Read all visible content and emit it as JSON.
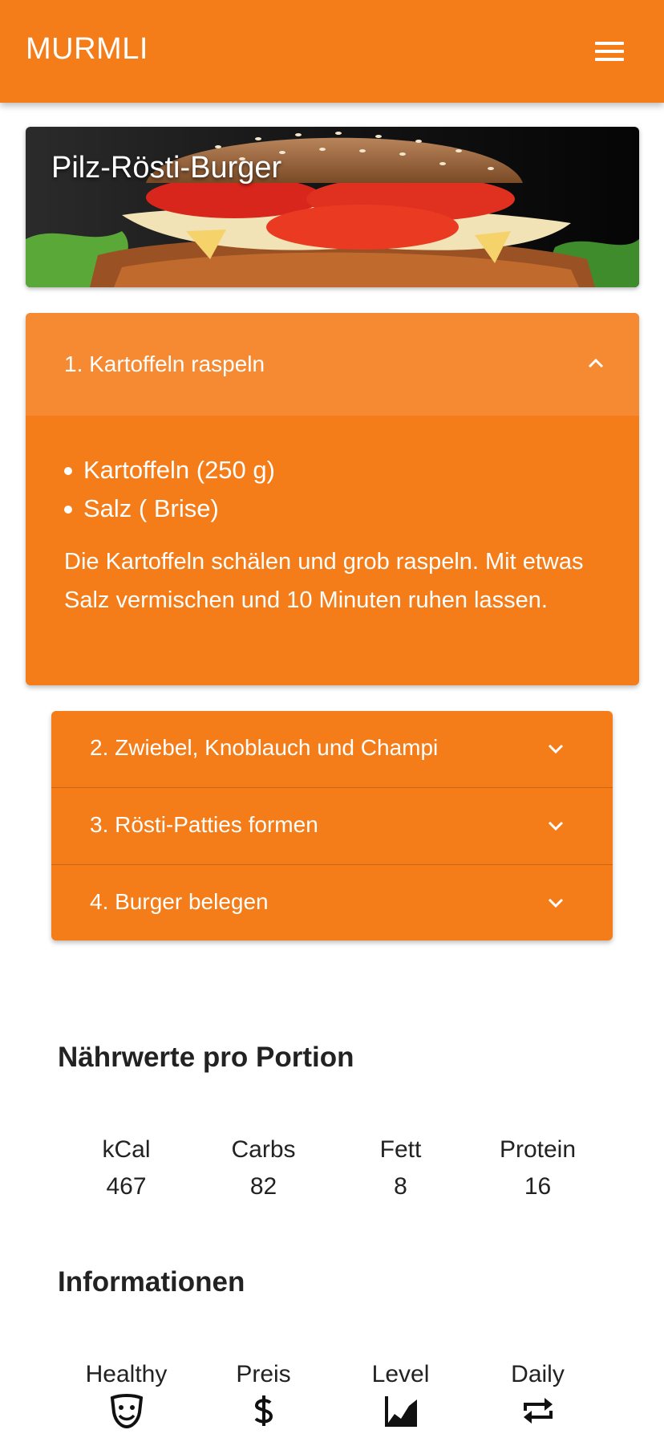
{
  "app": {
    "title": "MURMLI"
  },
  "recipe": {
    "title": "Pilz-Rösti-Burger"
  },
  "steps": {
    "open": {
      "label": "1. Kartoffeln raspeln",
      "ingredients": [
        "Kartoffeln (250 g)",
        "Salz ( Brise)"
      ],
      "text": "Die Kartoffeln schälen und grob raspeln. Mit etwas Salz vermischen und 10 Minuten ruhen lassen."
    },
    "collapsed": [
      {
        "label": "2. Zwiebel, Knoblauch und Champi"
      },
      {
        "label": "3. Rösti-Patties formen"
      },
      {
        "label": "4. Burger belegen"
      }
    ]
  },
  "nutrition": {
    "heading": "Nährwerte pro Portion",
    "items": [
      {
        "label": "kCal",
        "value": "467"
      },
      {
        "label": "Carbs",
        "value": "82"
      },
      {
        "label": "Fett",
        "value": "8"
      },
      {
        "label": "Protein",
        "value": "16"
      }
    ]
  },
  "info": {
    "heading": "Informationen",
    "items": [
      {
        "label": "Healthy",
        "icon": "theater-masks-icon"
      },
      {
        "label": "Preis",
        "icon": "dollar-icon"
      },
      {
        "label": "Level",
        "icon": "chart-line-icon"
      },
      {
        "label": "Daily",
        "icon": "repeat-icon"
      }
    ]
  },
  "colors": {
    "accent": "#f47d1a",
    "accent_light": "#f58a33"
  }
}
